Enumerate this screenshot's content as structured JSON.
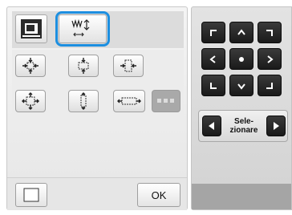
{
  "tabs": [
    {
      "icon": "embroidery-machine-icon",
      "selected": false
    },
    {
      "icon": "size-adjust-icon",
      "selected": true
    }
  ],
  "grid": {
    "row1": [
      "reduce-all-sides-icon",
      "reduce-height-icon",
      "reduce-width-icon"
    ],
    "row2": [
      "enlarge-all-sides-icon",
      "enlarge-height-icon",
      "enlarge-width-icon",
      "more-options-icon"
    ]
  },
  "bottom": {
    "ok_label": "OK",
    "square_icon": "frame-square-icon"
  },
  "arrows": {
    "rows": [
      [
        "up-left-arrow-icon",
        "up-arrow-icon",
        "up-right-arrow-icon"
      ],
      [
        "left-arrow-icon",
        "center-dot-icon",
        "right-arrow-icon"
      ],
      [
        "down-left-arrow-icon",
        "down-arrow-icon",
        "down-right-arrow-icon"
      ]
    ]
  },
  "selector": {
    "label_line1": "Sele-",
    "label_line2": "zionare"
  },
  "colors": {
    "highlight": "#1d8fe0",
    "dark_button": "#222222",
    "disabled_button": "#a9a9a9"
  }
}
